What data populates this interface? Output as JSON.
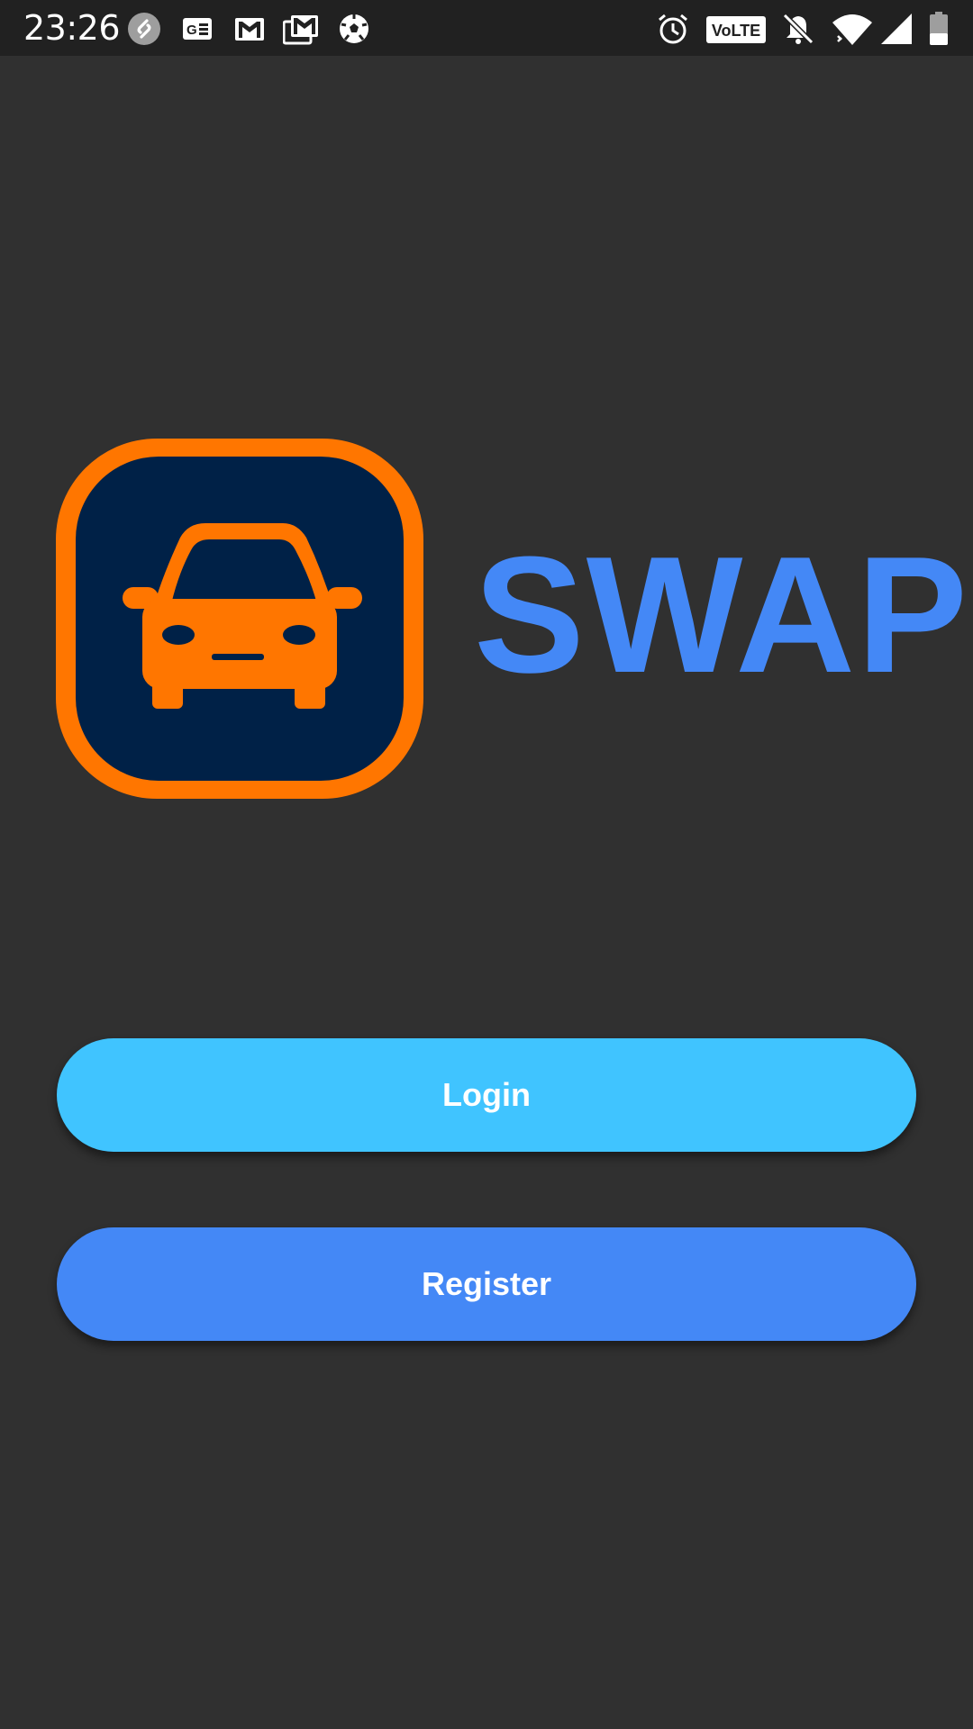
{
  "status_bar": {
    "time": "23:26",
    "left_icons": [
      "shazam-icon",
      "news-icon",
      "gmail-icon",
      "gmail-stack-icon",
      "soccer-ball-icon"
    ],
    "right_icons": [
      "alarm-icon",
      "volte-icon",
      "bell-off-icon",
      "wifi-icon",
      "cell-signal-icon",
      "battery-icon"
    ],
    "volte_label": "VoLTE"
  },
  "app": {
    "title": "SWAP",
    "logo_icon": "car-icon",
    "colors": {
      "background": "#303030",
      "logo_border": "#ff7600",
      "logo_fill": "#002147",
      "car": "#ff7600",
      "title": "#4488f6",
      "login_button": "#40c4ff",
      "register_button": "#4488f6"
    }
  },
  "buttons": {
    "login_label": "Login",
    "register_label": "Register"
  }
}
